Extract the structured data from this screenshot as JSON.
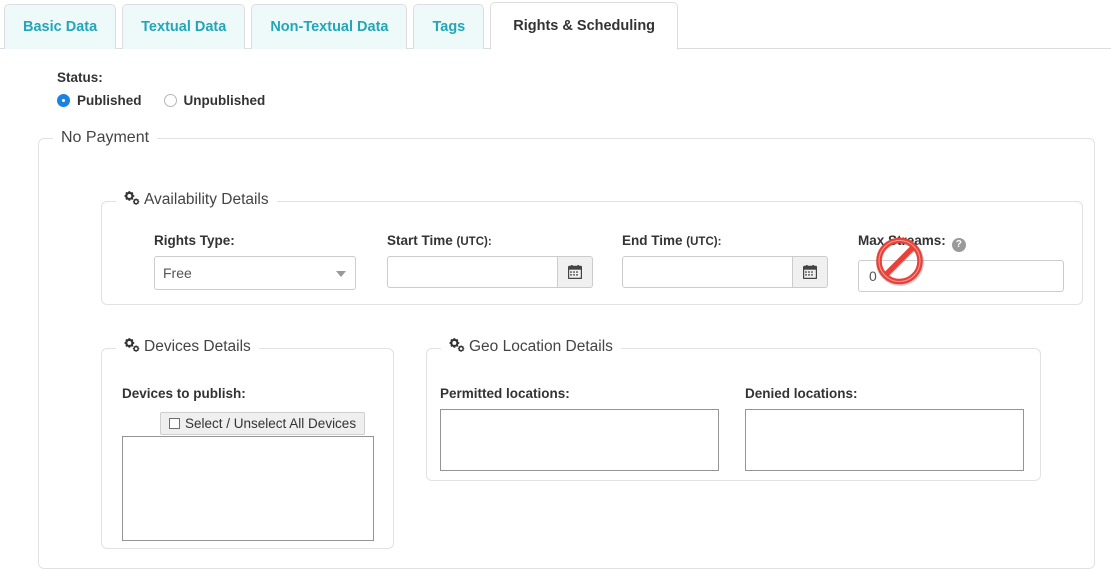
{
  "tabs": [
    {
      "label": "Basic Data",
      "active": false
    },
    {
      "label": "Textual Data",
      "active": false
    },
    {
      "label": "Non-Textual Data",
      "active": false
    },
    {
      "label": "Tags",
      "active": false
    },
    {
      "label": "Rights & Scheduling",
      "active": true
    }
  ],
  "status": {
    "label": "Status:",
    "options": [
      {
        "label": "Published",
        "selected": true
      },
      {
        "label": "Unpublished",
        "selected": false
      }
    ]
  },
  "payment_section": {
    "legend": "No Payment"
  },
  "availability": {
    "legend": "Availability Details",
    "icon": "cogs-icon",
    "rights_type": {
      "label": "Rights Type:",
      "value": "Free",
      "options": [
        "Free"
      ]
    },
    "start_time": {
      "label": "Start Time",
      "unit": "(UTC):",
      "value": "",
      "placeholder": "",
      "button_icon": "calendar-icon"
    },
    "end_time": {
      "label": "End Time",
      "unit": "(UTC):",
      "value": "",
      "placeholder": "",
      "button_icon": "calendar-icon"
    },
    "max_streams": {
      "label": "Max Streams:",
      "help_icon": "help-circle-icon",
      "help_glyph": "?",
      "value": "0",
      "placeholder": ""
    }
  },
  "devices": {
    "legend": "Devices Details",
    "icon": "cogs-icon",
    "label": "Devices to publish:",
    "select_all_label": "Select / Unselect All Devices",
    "list_items": []
  },
  "geo": {
    "legend": "Geo Location Details",
    "icon": "cogs-icon",
    "permitted": {
      "label": "Permitted locations:",
      "items": []
    },
    "denied": {
      "label": "Denied locations:",
      "items": []
    }
  },
  "cursor": {
    "type": "no-entry-cursor",
    "color": "#e8413a"
  },
  "colors": {
    "tab_text": "#23a6b8",
    "tab_bg": "#eefafa",
    "radio_accent": "#1a82e2",
    "border": "#e2e2e2"
  }
}
